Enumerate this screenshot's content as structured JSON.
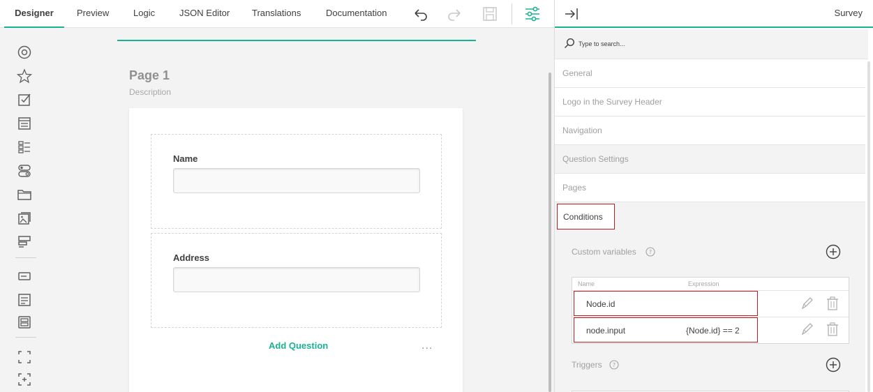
{
  "toolbar": {
    "tabs": [
      {
        "label": "Designer",
        "active": true
      },
      {
        "label": "Preview"
      },
      {
        "label": "Logic"
      },
      {
        "label": "JSON Editor"
      },
      {
        "label": "Translations"
      },
      {
        "label": "Documentation"
      }
    ],
    "icons": [
      "undo-icon",
      "redo-icon",
      "save-icon",
      "settings-sliders-icon"
    ],
    "accent": "#19b394"
  },
  "toolbox": {
    "icons": [
      "radiogroup-icon",
      "rating-icon",
      "checkbox-icon",
      "dropdown-icon",
      "ranking-icon",
      "boolean-icon",
      "file-icon",
      "imagepicker-icon",
      "matrix-icon",
      "text-icon",
      "comment-icon",
      "multipletext-icon",
      "panel-icon",
      "paneldynamic-icon"
    ]
  },
  "canvas": {
    "page_title": "Page 1",
    "page_description": "Description",
    "questions": [
      {
        "label": "Name"
      },
      {
        "label": "Address"
      }
    ],
    "add_question": "Add Question",
    "more": "..."
  },
  "properties": {
    "title": "Survey",
    "search_placeholder": "Type to search...",
    "categories": [
      {
        "label": "General"
      },
      {
        "label": "Logo in the Survey Header"
      },
      {
        "label": "Navigation"
      },
      {
        "label": "Question Settings"
      },
      {
        "label": "Pages"
      },
      {
        "label": "Conditions",
        "active": true
      }
    ],
    "custom_variables_label": "Custom variables",
    "variables_table": {
      "headers": [
        "Name",
        "Expression"
      ],
      "rows": [
        {
          "name": "Node.id",
          "expression": ""
        },
        {
          "name": "node.input",
          "expression": "{Node.id} == 2"
        }
      ]
    },
    "triggers_label": "Triggers",
    "highlight_color": "#c0191f"
  }
}
